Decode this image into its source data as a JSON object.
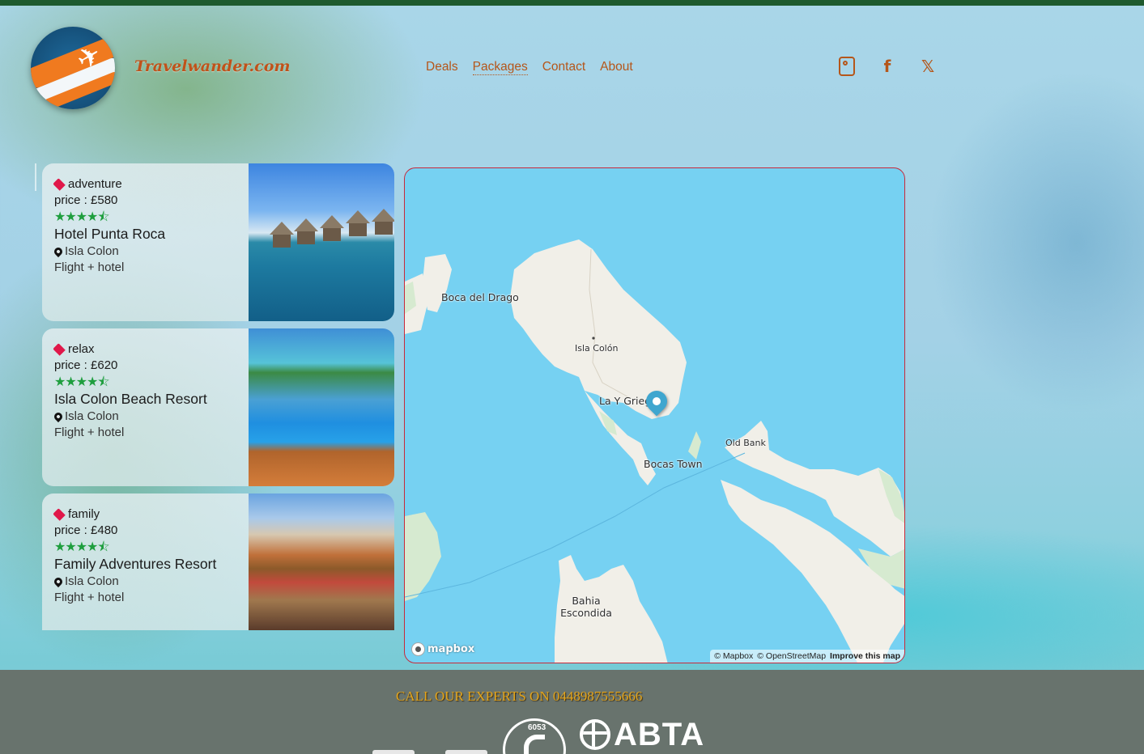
{
  "header": {
    "brand": "Travelwander.com",
    "nav": [
      "Deals",
      "Packages",
      "Contact",
      "About"
    ],
    "active_nav": "Packages",
    "social": [
      "instagram-icon",
      "facebook-icon",
      "x-icon"
    ]
  },
  "packages": [
    {
      "tag": "adventure",
      "price": "price : £580",
      "rating": 4.5,
      "stars": "★★★★⯪",
      "name": "Hotel Punta Roca",
      "location": "Isla Colon",
      "type": "Flight + hotel"
    },
    {
      "tag": "relax",
      "price": "price : £620",
      "rating": 4.5,
      "stars": "★★★★⯪",
      "name": "Isla Colon Beach Resort",
      "location": "Isla Colon",
      "type": "Flight + hotel"
    },
    {
      "tag": "family",
      "price": "price : £480",
      "rating": 4.5,
      "stars": "★★★★⯪",
      "name": "Family Adventures Resort",
      "location": "Isla Colon",
      "type": "Flight + hotel"
    }
  ],
  "map": {
    "labels": [
      "Boca del Drago",
      "Isla Colón",
      "La Y Griega",
      "Old Bank",
      "Bocas Town",
      "Bahia Escondida"
    ],
    "logo": "mapbox",
    "attribution": [
      "© Mapbox",
      "© OpenStreetMap",
      "Improve this map"
    ]
  },
  "footer": {
    "call_text": "CALL OUR EXPERTS ON 0448987555666",
    "atol_number": "6053",
    "abta": "ABTA"
  },
  "colors": {
    "accent": "#b5561a",
    "tag": "#e0184a",
    "stars": "#1e9e3e",
    "topbar": "#1e5a2e",
    "footer_bg": "#68736d",
    "call_text": "#e3a51d"
  }
}
